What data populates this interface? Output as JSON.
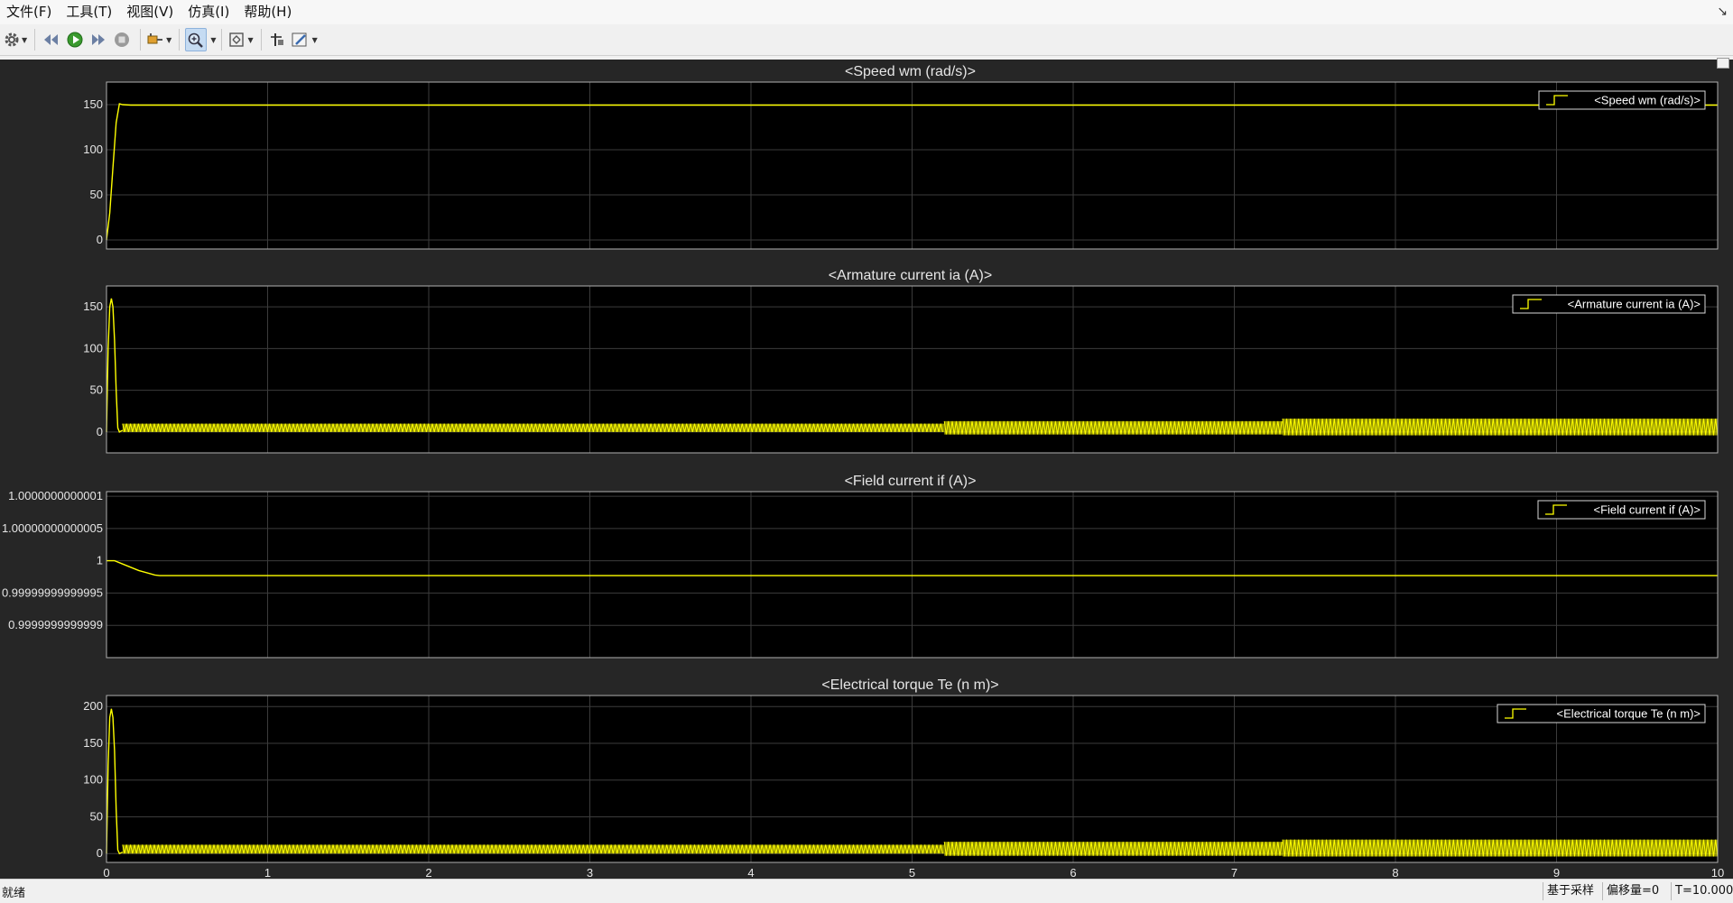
{
  "menu": [
    "文件(F)",
    "工具(T)",
    "视图(V)",
    "仿真(I)",
    "帮助(H)"
  ],
  "toolbar": {
    "buttons": [
      {
        "name": "settings-icon",
        "dropdown": true
      },
      {
        "name": "step-back-icon",
        "dropdown": false
      },
      {
        "name": "run-icon",
        "dropdown": false
      },
      {
        "name": "step-forward-icon",
        "dropdown": false
      },
      {
        "name": "stop-icon",
        "dropdown": false
      },
      {
        "name": "highlight-signal-icon",
        "dropdown": true
      },
      {
        "name": "zoom-in-icon",
        "dropdown": true,
        "active": true
      },
      {
        "name": "autoscale-icon",
        "dropdown": true
      },
      {
        "name": "cursor-measure-icon",
        "dropdown": false
      },
      {
        "name": "style-edit-icon",
        "dropdown": true
      }
    ]
  },
  "status": {
    "text": "就绪",
    "sampling": "基于采样",
    "offset": "偏移量=0",
    "time": "T=10.000"
  },
  "colors": {
    "background": "#262626",
    "axes_bg": "#000000",
    "axes_edge": "#b0b0b0",
    "grid": "#3c3c3c",
    "line": "#ffff00"
  },
  "chart_data": [
    {
      "type": "line",
      "title": "<Speed wm (rad/s)>",
      "legend": "<Speed wm (rad/s)>",
      "legend_position": "top-right",
      "grid": true,
      "xlim": [
        0,
        10
      ],
      "ylim": [
        -10,
        175
      ],
      "yticks": [
        0,
        50,
        100,
        150
      ],
      "ytick_labels": [
        "0",
        "50",
        "100",
        "150"
      ],
      "x": [
        0,
        0.02,
        0.04,
        0.06,
        0.08,
        0.1,
        0.15,
        0.2,
        1,
        3,
        5,
        7,
        10
      ],
      "y": [
        0,
        30,
        80,
        130,
        151,
        150,
        149.5,
        149.5,
        149.5,
        149.5,
        149.5,
        149.5,
        149.5
      ]
    },
    {
      "type": "line",
      "title": "<Armature current ia (A)>",
      "legend": "<Armature current ia (A)>",
      "legend_position": "top-right",
      "grid": true,
      "xlim": [
        0,
        10
      ],
      "ylim": [
        -25,
        175
      ],
      "yticks": [
        0,
        50,
        100,
        150
      ],
      "ytick_labels": [
        "0",
        "50",
        "100",
        "150"
      ],
      "x": [
        0,
        0.01,
        0.02,
        0.03,
        0.04,
        0.05,
        0.06,
        0.07,
        0.08,
        0.1
      ],
      "y": [
        0,
        100,
        150,
        160,
        150,
        110,
        50,
        5,
        0,
        2
      ],
      "ripple": [
        {
          "from": 0.1,
          "to": 5.2,
          "low": 0,
          "high": 10
        },
        {
          "from": 5.2,
          "to": 7.3,
          "low": -3,
          "high": 13
        },
        {
          "from": 7.3,
          "to": 10,
          "low": -4,
          "high": 16
        }
      ]
    },
    {
      "type": "line",
      "title": "<Field current if (A)>",
      "legend": "<Field current if (A)>",
      "legend_position": "top-right",
      "grid": true,
      "xlim": [
        0,
        10
      ],
      "ylim": [
        0.99999999999985,
        1.000000000000107
      ],
      "yticks": [
        0.9999999999999,
        0.99999999999995,
        1,
        1.00000000000005,
        1.0000000000001
      ],
      "ytick_labels": [
        "0.9999999999999",
        "0.99999999999995",
        "1",
        "1.00000000000005",
        "1.0000000000001"
      ],
      "x": [
        0,
        0.05,
        0.1,
        0.2,
        0.3,
        0.33,
        1,
        5,
        10
      ],
      "y": [
        1,
        1,
        0.999999999999995,
        0.999999999999985,
        0.999999999999978,
        0.999999999999977,
        0.999999999999977,
        0.999999999999977,
        0.999999999999977
      ]
    },
    {
      "type": "line",
      "title": "<Electrical torque Te (n m)>",
      "legend": "<Electrical torque Te (n m)>",
      "legend_position": "top-right",
      "grid": true,
      "xlim": [
        0,
        10
      ],
      "ylim": [
        -12,
        215
      ],
      "yticks": [
        0,
        50,
        100,
        150,
        200
      ],
      "ytick_labels": [
        "0",
        "50",
        "100",
        "150",
        "200"
      ],
      "xticks": [
        0,
        1,
        2,
        3,
        4,
        5,
        6,
        7,
        8,
        9,
        10
      ],
      "xtick_labels": [
        "0",
        "1",
        "2",
        "3",
        "4",
        "5",
        "6",
        "7",
        "8",
        "9",
        "10"
      ],
      "x": [
        0,
        0.01,
        0.02,
        0.03,
        0.04,
        0.05,
        0.06,
        0.07,
        0.08,
        0.1
      ],
      "y": [
        0,
        120,
        185,
        197,
        185,
        140,
        60,
        5,
        0,
        2
      ],
      "ripple": [
        {
          "from": 0.1,
          "to": 5.2,
          "low": 0,
          "high": 12
        },
        {
          "from": 5.2,
          "to": 7.3,
          "low": -3,
          "high": 16
        },
        {
          "from": 7.3,
          "to": 10,
          "low": -4,
          "high": 19
        }
      ]
    }
  ]
}
